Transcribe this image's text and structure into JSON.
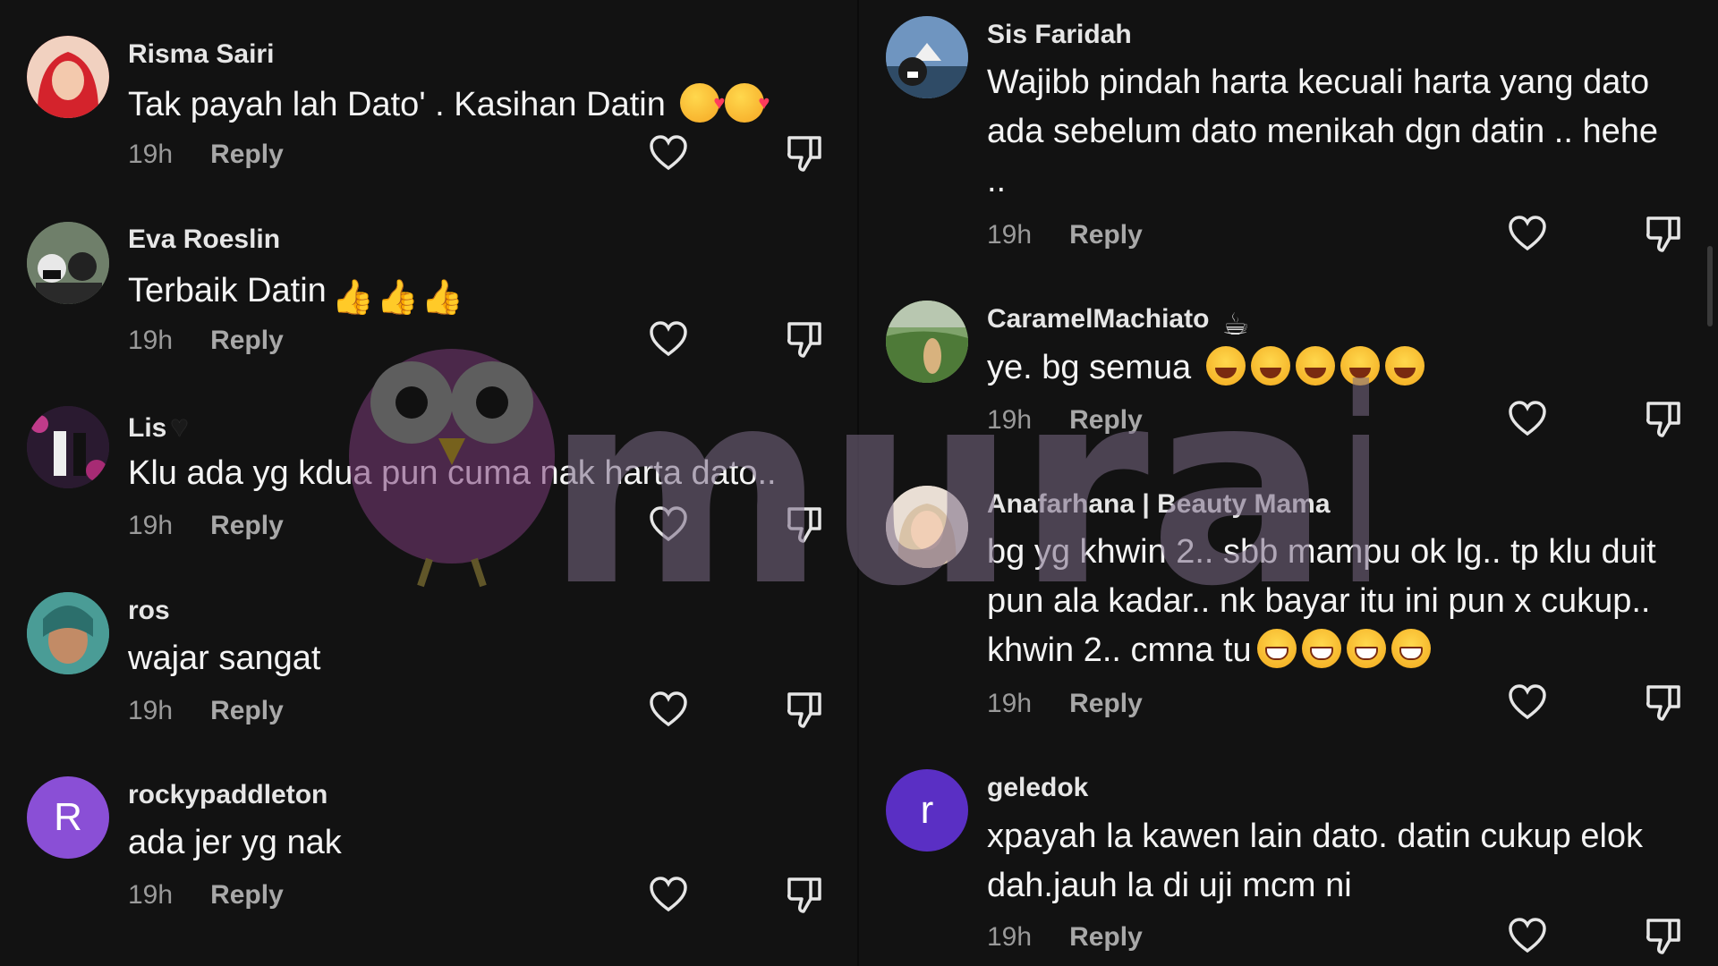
{
  "left_comments": [
    {
      "username": "Risma Sairi",
      "text": "Tak payah lah Dato' . Kasihan Datin",
      "emojis": [
        "love",
        "love"
      ],
      "time": "19h",
      "reply": "Reply",
      "avatar_color": "#c4434a"
    },
    {
      "username": "Eva Roeslin",
      "text": "Terbaik Datin",
      "emojis": [
        "thumb",
        "thumb",
        "thumb"
      ],
      "time": "19h",
      "reply": "Reply",
      "avatar_color": "#5d6c5a"
    },
    {
      "username": "Lis",
      "text": "Klu ada yg kdua pun cuma nak harta dato..",
      "emojis": [],
      "time": "19h",
      "reply": "Reply",
      "avatar_color": "#3a2440"
    },
    {
      "username": "ros",
      "text": "wajar sangat",
      "emojis": [],
      "time": "19h",
      "reply": "Reply",
      "avatar_color": "#3f8f8a"
    },
    {
      "username": "rockypaddleton",
      "text": "ada jer yg nak",
      "emojis": [],
      "time": "19h",
      "reply": "Reply",
      "avatar_color": "#8a4fd6",
      "avatar_letter": "R"
    }
  ],
  "right_comments": [
    {
      "username": "Sis Faridah",
      "text": "Wajibb pindah harta kecuali harta yang dato ada sebelum dato menikah dgn datin .. hehe ..",
      "emojis": [],
      "time": "19h",
      "reply": "Reply",
      "avatar_color": "#41627f"
    },
    {
      "username": "CaramelMachiato",
      "text": "ye. bg semua",
      "emojis": [
        "laugh",
        "laugh",
        "laugh",
        "laugh",
        "laugh"
      ],
      "time": "19h",
      "reply": "Reply",
      "avatar_color": "#4f7a3e"
    },
    {
      "username": "Anafarhana | Beauty Mama",
      "text": "bg yg khwin 2.. sbb mampu ok lg.. tp klu duit pun ala kadar.. nk bayar itu ini pun x cukup.. khwin 2.. cmna tu",
      "emojis": [
        "grin",
        "grin",
        "grin",
        "grin"
      ],
      "time": "19h",
      "reply": "Reply",
      "avatar_color": "#d9c8b8"
    },
    {
      "username": "geledok",
      "text": "xpayah la kawen lain dato. datin cukup elok dah.jauh la di uji mcm ni",
      "emojis": [],
      "time": "19h",
      "reply": "Reply",
      "avatar_color": "#5a2fc4",
      "avatar_letter": "r"
    }
  ],
  "watermark": {
    "text": "murai"
  },
  "colors": {
    "background": "#121212",
    "text": "#f4f4f4",
    "muted": "#9a9a9a"
  }
}
